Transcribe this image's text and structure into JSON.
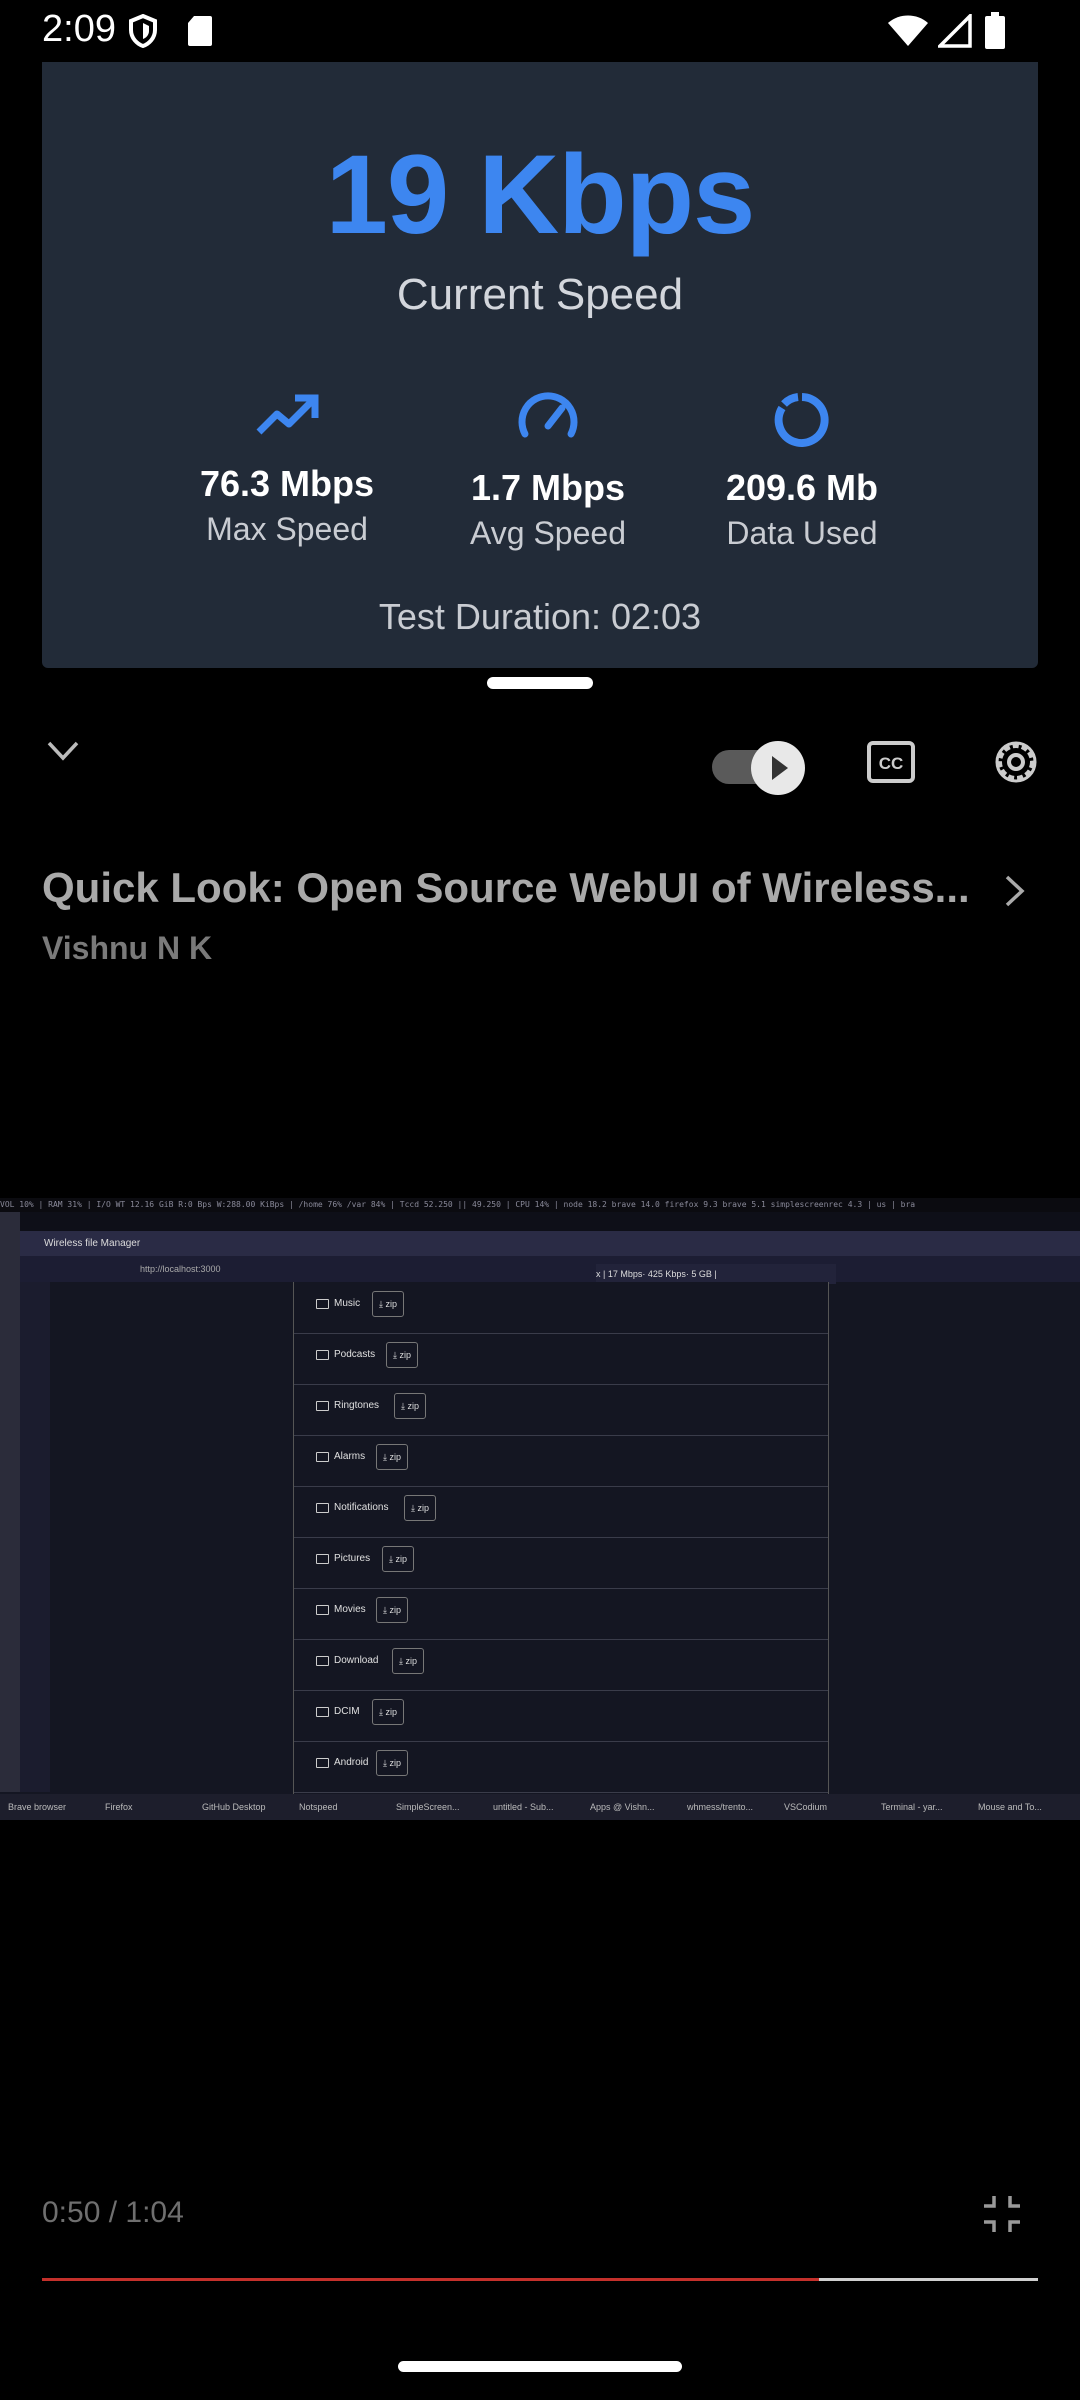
{
  "status_bar": {
    "time": "2:09",
    "icons": [
      "shield-icon",
      "sd-card-icon",
      "wifi-icon",
      "cellular-signal-icon",
      "battery-icon"
    ]
  },
  "overlay": {
    "current_speed": "19 Kbps",
    "current_speed_label": "Current Speed",
    "stats": [
      {
        "icon": "trending-up-icon",
        "value": "76.3 Mbps",
        "label": "Max Speed"
      },
      {
        "icon": "speedometer-icon",
        "value": "1.7 Mbps",
        "label": "Avg Speed"
      },
      {
        "icon": "data-circle-icon",
        "value": "209.6 Mb",
        "label": "Data Used"
      }
    ],
    "duration": "Test Duration: 02:03",
    "accent_color": "#3d86f0"
  },
  "player": {
    "title": "Quick Look: Open Source WebUI of Wireless...",
    "channel": "Vishnu N K",
    "timecode": "0:50 / 1:04",
    "progress": 0.78,
    "autoplay_on": true
  },
  "video": {
    "sysbar": "VOL 10% | RAM 31% | I/O WT 12.16 GiB R:0 Bps W:288.00 KiBps | /home 76% /var 84% | Tccd 52.250 || 49.250 | CPU 14% | node 18.2 brave 14.0 firefox 9.3 brave 5.1 simplescreenrec 4.3 | us | bra",
    "window_title": "Wireless file Manager",
    "address": "http://localhost:3000",
    "toast": "x   | 17 Mbps· 425 Kbps· 5 GB |",
    "folders": [
      "Music",
      "Podcasts",
      "Ringtones",
      "Alarms",
      "Notifications",
      "Pictures",
      "Movies",
      "Download",
      "DCIM",
      "Android"
    ],
    "zip_label": "zip",
    "taskbar": [
      "Brave browser",
      "Firefox",
      "GitHub Desktop",
      "Notspeed",
      "SimpleScreen...",
      "untitled - Sub...",
      "Apps @ Vishn...",
      "whmess/trento...",
      "VSCodium",
      "Terminal - yar...",
      "Mouse and To..."
    ]
  }
}
